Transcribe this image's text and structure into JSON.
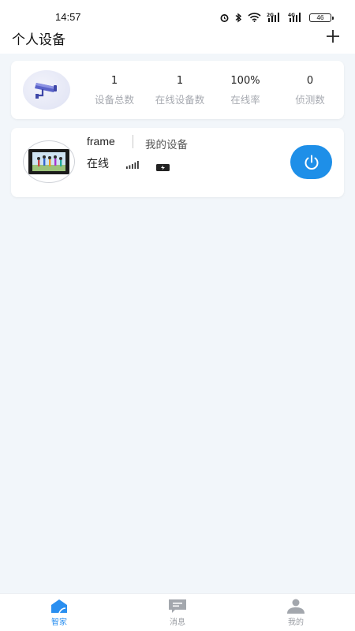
{
  "status_bar": {
    "time": "14:57",
    "battery": "46",
    "net1": "2G",
    "net2": "4G"
  },
  "header": {
    "title": "个人设备"
  },
  "stats": [
    {
      "value": "1",
      "label": "设备总数"
    },
    {
      "value": "1",
      "label": "在线设备数"
    },
    {
      "value": "100%",
      "label": "在线率"
    },
    {
      "value": "0",
      "label": "侦测数"
    }
  ],
  "device": {
    "name": "frame",
    "group": "我的设备",
    "status": "在线"
  },
  "tabs": [
    {
      "label": "智家",
      "icon": "home-icon",
      "active": true
    },
    {
      "label": "消息",
      "icon": "message-icon",
      "active": false
    },
    {
      "label": "我的",
      "icon": "profile-icon",
      "active": false
    }
  ],
  "colors": {
    "accent": "#1e8fe8",
    "background": "#f2f6fa",
    "muted": "#a6a9b0"
  }
}
